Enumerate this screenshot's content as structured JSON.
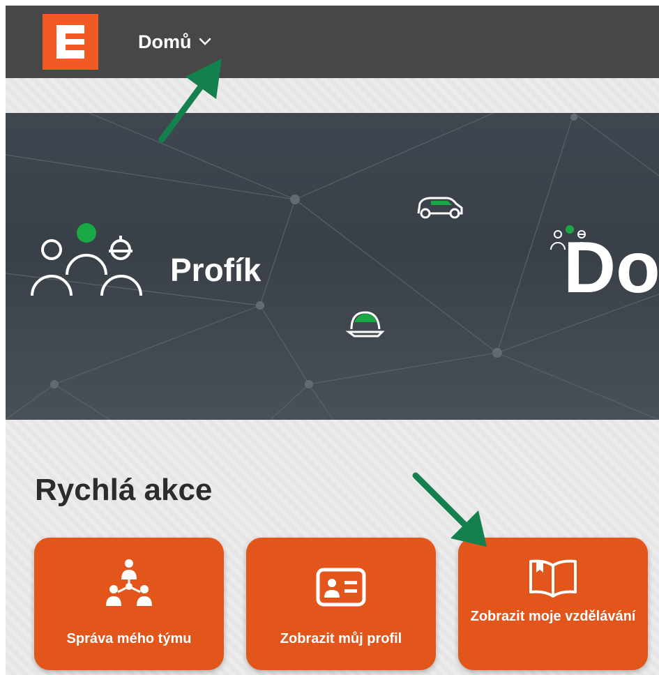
{
  "header": {
    "logo_alt": "ČEZ logo",
    "nav_label": "Domů"
  },
  "hero": {
    "brand": "Profík",
    "partial_heading": "Do"
  },
  "quick_actions": {
    "title": "Rychlá akce",
    "tiles": [
      {
        "label": "Správa mého týmu",
        "icon": "team-hierarchy-icon"
      },
      {
        "label": "Zobrazit můj profil",
        "icon": "id-card-icon"
      },
      {
        "label": "Zobrazit moje vzdělávání",
        "icon": "open-book-icon"
      }
    ]
  },
  "colors": {
    "topbar": "#474747",
    "accent_orange": "#e2561b",
    "logo_orange": "#f15a22",
    "highlight_green": "#1aa745",
    "annotation_arrow": "#13804d"
  }
}
